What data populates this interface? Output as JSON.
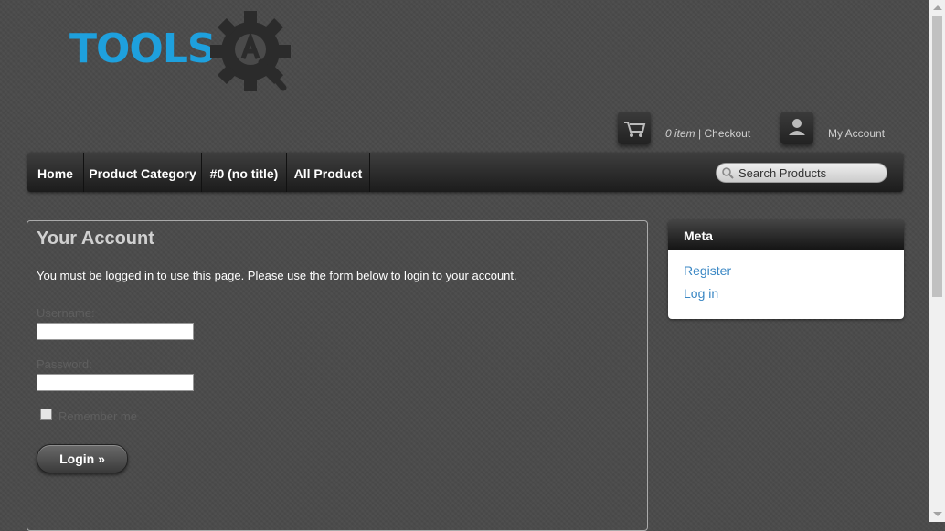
{
  "brand": {
    "logo_text": "TOOLS",
    "logo_color": "#1ea0dd"
  },
  "header": {
    "cart_count": "0 item",
    "cart_separator": " | ",
    "checkout_label": "Checkout",
    "account_label": "My Account",
    "cart_icon": "shopping-cart-icon",
    "account_icon": "user-icon"
  },
  "nav": {
    "items": [
      {
        "label": "Home"
      },
      {
        "label": "Product Category"
      },
      {
        "label": "#0 (no title)"
      },
      {
        "label": "All Product"
      }
    ],
    "search_placeholder": "Search Products"
  },
  "account": {
    "title": "Your Account",
    "message": "You must be logged in to use this page. Please use the form below to login to your account.",
    "username_label": "Username:",
    "username_value": "",
    "password_label": "Password:",
    "password_value": "",
    "remember_label": "Remember me",
    "remember_checked": false,
    "login_label": "Login »"
  },
  "meta": {
    "title": "Meta",
    "links": [
      {
        "label": "Register"
      },
      {
        "label": "Log in"
      }
    ],
    "link_color": "#3a87c4"
  }
}
